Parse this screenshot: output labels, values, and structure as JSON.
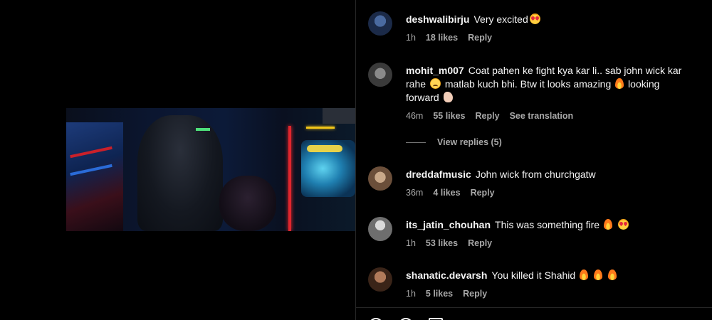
{
  "comments": [
    {
      "username": "deshwalibirju",
      "text": "Very excited",
      "emojis": [
        "smiling-face-with-heart-eyes"
      ],
      "time": "1h",
      "likes": "18 likes",
      "reply": "Reply"
    },
    {
      "username": "mohit_m007",
      "text_part1": "Coat pahen ke fight kya kar li.. sab john wick kar rahe",
      "text_part2": "matlab kuch bhi. Btw it looks amazing",
      "text_part3": "looking forward",
      "emojis": [
        "sad-face",
        "fire",
        "waving-hand"
      ],
      "time": "46m",
      "likes": "55 likes",
      "reply": "Reply",
      "translate": "See translation"
    },
    {
      "username": "dreddafmusic",
      "text": "John wick from churchgatw",
      "time": "36m",
      "likes": "4 likes",
      "reply": "Reply"
    },
    {
      "username": "its_jatin_chouhan",
      "text": "This was something fire",
      "emojis": [
        "fire",
        "smiling-face-with-heart-eyes"
      ],
      "time": "1h",
      "likes": "53 likes",
      "reply": "Reply"
    },
    {
      "username": "shanatic.devarsh",
      "text": "You killed it Shahid",
      "emojis": [
        "fire",
        "fire",
        "fire"
      ],
      "time": "1h",
      "likes": "5 likes",
      "reply": "Reply"
    }
  ],
  "view_replies": "View replies (5)",
  "colors": {
    "background": "#000000",
    "text_primary": "#f5f5f5",
    "text_secondary": "#a8a8a8",
    "divider": "#262626"
  }
}
